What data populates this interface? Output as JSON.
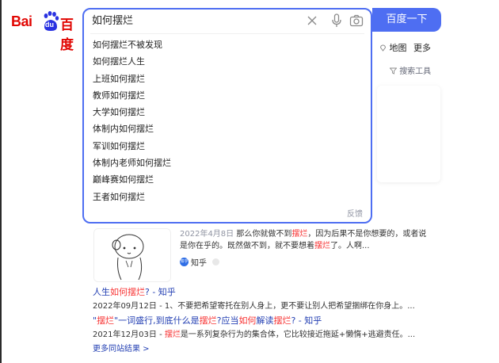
{
  "logo": {
    "bai": "Bai",
    "du": "du",
    "baidu": "百度"
  },
  "search": {
    "query": "如何摆烂",
    "button_label": "百度一下",
    "suggestions": [
      "如何摆烂不被发现",
      "如何摆烂人生",
      "上班如何摆烂",
      "教师如何摆烂",
      "大学如何摆烂",
      "体制内如何摆烂",
      "军训如何摆烂",
      "体制内老师如何摆烂",
      "巅峰赛如何摆烂",
      "王者如何摆烂"
    ],
    "feedback": "反馈"
  },
  "nav": {
    "map": "地图",
    "more": "更多",
    "search_tools": "搜索工具"
  },
  "result1": {
    "date": "2022年4月8日",
    "text_a": "那么你就做不到",
    "kw1": "摆烂",
    "text_b": "，因为后果不是你想要的，或者说是你在乎的。既然做不到，就不要想着",
    "kw2": "摆烂",
    "text_c": "了。人啊...",
    "source": "知乎",
    "source_badge": "知乎"
  },
  "result2": {
    "title_a": "人生",
    "title_kw": "如何摆烂",
    "title_b": "? - 知乎",
    "desc": "2022年09月12日 - 1、不要把希望寄托在别人身上，更不要让别人把希望捆绑在你身上。..."
  },
  "result3": {
    "title_a": "\"",
    "title_kw1": "摆烂",
    "title_b": "\"一词盛行,到底什么是",
    "title_kw2": "摆烂",
    "title_c": "?应当",
    "title_kw3": "如何",
    "title_d": "解读",
    "title_kw4": "摆烂",
    "title_e": "? - 知乎",
    "desc_date": "2021年12月03日 - ",
    "desc_kw": "摆烂",
    "desc_rest": "是一系列复杂行为的集合体，它比较接近拖延+懒惰+逃避责任。..."
  },
  "more_results": "更多同站结果 >"
}
